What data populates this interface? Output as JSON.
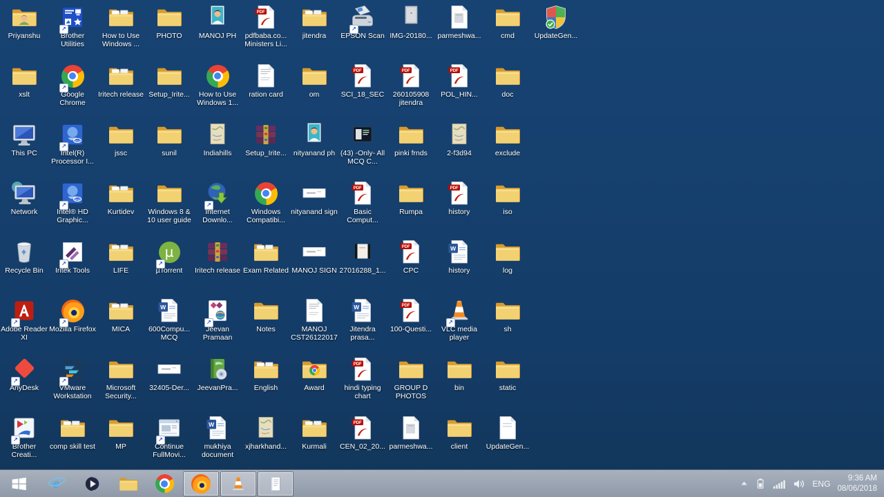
{
  "desktop": {
    "background_color": "#174373",
    "icons": [
      {
        "label": "Priyanshu",
        "type": "folder-person",
        "col": 1,
        "row": 1
      },
      {
        "label": "Brother Utilities",
        "type": "brother-utilities",
        "col": 2,
        "row": 1,
        "shortcut": true
      },
      {
        "label": "How to Use Windows ...",
        "type": "folder-docs",
        "col": 3,
        "row": 1
      },
      {
        "label": "PHOTO",
        "type": "folder",
        "col": 4,
        "row": 1
      },
      {
        "label": "MANOJ PH",
        "type": "photo-person",
        "col": 5,
        "row": 1
      },
      {
        "label": "pdfbaba.co... Ministers Li...",
        "type": "pdf",
        "col": 6,
        "row": 1
      },
      {
        "label": "jitendra",
        "type": "folder-docs",
        "col": 7,
        "row": 1
      },
      {
        "label": "EPSON Scan",
        "type": "scanner",
        "col": 8,
        "row": 1,
        "shortcut": true
      },
      {
        "label": "IMG-20180...",
        "type": "photo-grey",
        "col": 9,
        "row": 1
      },
      {
        "label": "parmeshwa...",
        "type": "page-grey",
        "col": 10,
        "row": 1
      },
      {
        "label": "cmd",
        "type": "folder",
        "col": 11,
        "row": 1
      },
      {
        "label": "UpdateGen...",
        "type": "shield",
        "col": 12,
        "row": 1
      },
      {
        "label": "xslt",
        "type": "folder",
        "col": 1,
        "row": 2
      },
      {
        "label": "Google Chrome",
        "type": "chrome",
        "col": 2,
        "row": 2,
        "shortcut": true
      },
      {
        "label": "Iritech release",
        "type": "folder-docs",
        "col": 3,
        "row": 2
      },
      {
        "label": "Setup_Irite...",
        "type": "folder",
        "col": 4,
        "row": 2
      },
      {
        "label": "How to Use Windows 1...",
        "type": "chrome",
        "col": 5,
        "row": 2
      },
      {
        "label": "ration card",
        "type": "page-text",
        "col": 6,
        "row": 2
      },
      {
        "label": "om",
        "type": "folder",
        "col": 7,
        "row": 2
      },
      {
        "label": "SCI_18_SEC",
        "type": "pdf",
        "col": 8,
        "row": 2
      },
      {
        "label": "260105908 jitendra",
        "type": "pdf",
        "col": 9,
        "row": 2
      },
      {
        "label": "POL_HIN...",
        "type": "pdf",
        "col": 10,
        "row": 2
      },
      {
        "label": "doc",
        "type": "folder",
        "col": 11,
        "row": 2
      },
      {
        "label": "This PC",
        "type": "this-pc",
        "col": 1,
        "row": 3
      },
      {
        "label": "Intel(R) Processor I...",
        "type": "intel",
        "col": 2,
        "row": 3,
        "shortcut": true
      },
      {
        "label": "jssc",
        "type": "folder",
        "col": 3,
        "row": 3
      },
      {
        "label": "sunil",
        "type": "folder",
        "col": 4,
        "row": 3
      },
      {
        "label": "Indiahills",
        "type": "map",
        "col": 5,
        "row": 3
      },
      {
        "label": "Setup_Irite...",
        "type": "winrar",
        "col": 6,
        "row": 3
      },
      {
        "label": "nityanand ph",
        "type": "photo-person",
        "col": 7,
        "row": 3
      },
      {
        "label": "(43) -Only- All MCQ C...",
        "type": "thumb-dark",
        "col": 8,
        "row": 3
      },
      {
        "label": "pinki frnds",
        "type": "folder",
        "col": 9,
        "row": 3
      },
      {
        "label": "2-f3d94",
        "type": "map",
        "col": 10,
        "row": 3
      },
      {
        "label": "exclude",
        "type": "folder",
        "col": 11,
        "row": 3
      },
      {
        "label": "Network",
        "type": "network",
        "col": 1,
        "row": 4
      },
      {
        "label": "Intel® HD Graphic...",
        "type": "intel",
        "col": 2,
        "row": 4,
        "shortcut": true
      },
      {
        "label": "Kurtidev",
        "type": "folder-docs",
        "col": 3,
        "row": 4
      },
      {
        "label": "Windows 8 & 10 user guide",
        "type": "folder",
        "col": 4,
        "row": 4
      },
      {
        "label": "Internet Downlo...",
        "type": "idm",
        "col": 5,
        "row": 4,
        "shortcut": true
      },
      {
        "label": "Windows Compatibi...",
        "type": "chrome",
        "col": 6,
        "row": 4
      },
      {
        "label": "nityanand sign",
        "type": "sign",
        "col": 7,
        "row": 4
      },
      {
        "label": "Basic Comput...",
        "type": "pdf",
        "col": 8,
        "row": 4
      },
      {
        "label": "Rumpa",
        "type": "folder",
        "col": 9,
        "row": 4
      },
      {
        "label": "history",
        "type": "pdf",
        "col": 10,
        "row": 4
      },
      {
        "label": "iso",
        "type": "folder",
        "col": 11,
        "row": 4
      },
      {
        "label": "Recycle Bin",
        "type": "recycle-bin",
        "col": 1,
        "row": 5
      },
      {
        "label": "Iritek Tools",
        "type": "iritek",
        "col": 2,
        "row": 5,
        "shortcut": true
      },
      {
        "label": "LIFE",
        "type": "folder-docs",
        "col": 3,
        "row": 5
      },
      {
        "label": "µTorrent",
        "type": "utorrent",
        "col": 4,
        "row": 5,
        "shortcut": true
      },
      {
        "label": "Iritech release",
        "type": "winrar",
        "col": 5,
        "row": 5
      },
      {
        "label": "Exam Related",
        "type": "folder-docs",
        "col": 6,
        "row": 5
      },
      {
        "label": "MANOJ SIGN",
        "type": "sign",
        "col": 7,
        "row": 5
      },
      {
        "label": "27016288_1...",
        "type": "photo-strip",
        "col": 8,
        "row": 5
      },
      {
        "label": "CPC",
        "type": "pdf",
        "col": 9,
        "row": 5
      },
      {
        "label": "history",
        "type": "word",
        "col": 10,
        "row": 5
      },
      {
        "label": "log",
        "type": "folder",
        "col": 11,
        "row": 5
      },
      {
        "label": "Adobe Reader XI",
        "type": "adobe",
        "col": 1,
        "row": 6,
        "shortcut": true
      },
      {
        "label": "Mozilla Firefox",
        "type": "firefox",
        "col": 2,
        "row": 6,
        "shortcut": true
      },
      {
        "label": "MICA",
        "type": "folder-docs",
        "col": 3,
        "row": 6
      },
      {
        "label": "600Compu... MCQ",
        "type": "word",
        "col": 4,
        "row": 6
      },
      {
        "label": "Jeevan Pramaan",
        "type": "jeevan",
        "col": 5,
        "row": 6,
        "shortcut": true
      },
      {
        "label": "Notes",
        "type": "folder",
        "col": 6,
        "row": 6
      },
      {
        "label": "MANOJ CST26122017",
        "type": "page-text",
        "col": 7,
        "row": 6
      },
      {
        "label": "Jitendra prasa...",
        "type": "word",
        "col": 8,
        "row": 6
      },
      {
        "label": "100-Questi...",
        "type": "pdf",
        "col": 9,
        "row": 6
      },
      {
        "label": "VLC media player",
        "type": "vlc",
        "col": 10,
        "row": 6,
        "shortcut": true
      },
      {
        "label": "sh",
        "type": "folder",
        "col": 11,
        "row": 6
      },
      {
        "label": "AnyDesk",
        "type": "anydesk",
        "col": 1,
        "row": 7,
        "shortcut": true
      },
      {
        "label": "VMware Workstation",
        "type": "vmware",
        "col": 2,
        "row": 7,
        "shortcut": true
      },
      {
        "label": "Microsoft Security...",
        "type": "folder",
        "col": 3,
        "row": 7
      },
      {
        "label": "32405-Der...",
        "type": "sign",
        "col": 4,
        "row": 7
      },
      {
        "label": "JeevanPra...",
        "type": "green-book",
        "col": 5,
        "row": 7
      },
      {
        "label": "English",
        "type": "folder-docs",
        "col": 6,
        "row": 7
      },
      {
        "label": "Award",
        "type": "folder-chrome",
        "col": 7,
        "row": 7
      },
      {
        "label": "hindi typing chart",
        "type": "pdf",
        "col": 8,
        "row": 7
      },
      {
        "label": "GROUP D PHOTOS",
        "type": "folder",
        "col": 9,
        "row": 7
      },
      {
        "label": "bin",
        "type": "folder",
        "col": 10,
        "row": 7
      },
      {
        "label": "static",
        "type": "folder",
        "col": 11,
        "row": 7
      },
      {
        "label": "Brother Creati...",
        "type": "brother-creative",
        "col": 1,
        "row": 8,
        "shortcut": true
      },
      {
        "label": "comp skill test",
        "type": "folder-docs",
        "col": 2,
        "row": 8
      },
      {
        "label": "MP",
        "type": "folder",
        "col": 3,
        "row": 8
      },
      {
        "label": "Continue FullMovi...",
        "type": "app-window",
        "col": 4,
        "row": 8,
        "shortcut": true
      },
      {
        "label": "mukhiya document",
        "type": "word",
        "col": 5,
        "row": 8
      },
      {
        "label": "xjharkhand...",
        "type": "map",
        "col": 6,
        "row": 8
      },
      {
        "label": "Kurmali",
        "type": "folder-docs",
        "col": 7,
        "row": 8
      },
      {
        "label": "CEN_02_20...",
        "type": "pdf",
        "col": 8,
        "row": 8
      },
      {
        "label": "parmeshwa...",
        "type": "page-grey",
        "col": 9,
        "row": 8
      },
      {
        "label": "client",
        "type": "folder",
        "col": 10,
        "row": 8
      },
      {
        "label": "UpdateGen...",
        "type": "page",
        "col": 11,
        "row": 8
      }
    ]
  },
  "taskbar": {
    "background_color": "#98A1B0",
    "items": [
      {
        "name": "start-button",
        "icon": "windows",
        "active": false
      },
      {
        "name": "internet-explorer",
        "icon": "ie",
        "active": false
      },
      {
        "name": "media-player",
        "icon": "kmplayer",
        "active": false
      },
      {
        "name": "file-explorer",
        "icon": "explorer",
        "active": false
      },
      {
        "name": "chrome",
        "icon": "chrome",
        "active": false
      },
      {
        "name": "firefox",
        "icon": "firefox",
        "active": true
      },
      {
        "name": "vlc",
        "icon": "vlc",
        "active": true
      },
      {
        "name": "notepad",
        "icon": "notepad",
        "active": true
      }
    ],
    "tray": {
      "icons": [
        "chevron-up",
        "battery",
        "network-signal",
        "volume"
      ],
      "language": "ENG",
      "time": "9:36 AM",
      "date": "08/06/2018"
    }
  },
  "icon_art": {
    "pdf_label": "PDF",
    "word_letter": "W",
    "utorrent_glyph": "µ",
    "ie_letter": "e",
    "intel_label": "intel",
    "shortcut_arrow": "↗"
  }
}
